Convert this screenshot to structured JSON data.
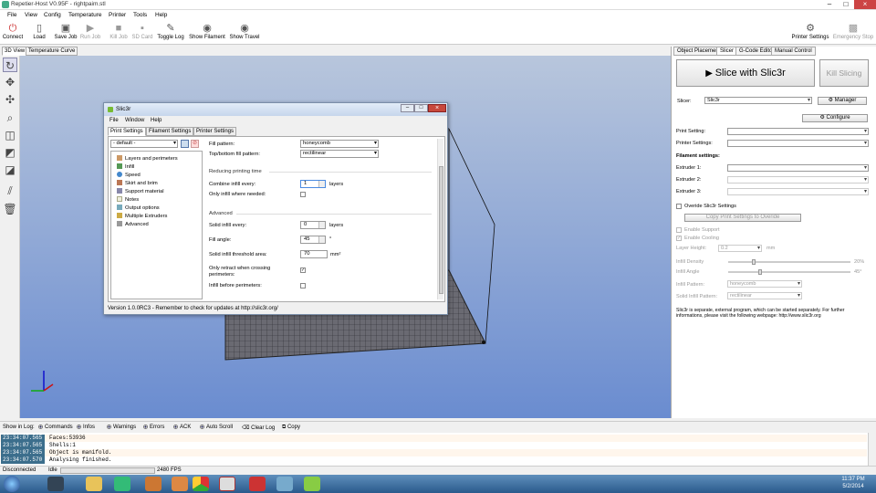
{
  "window": {
    "title": "Repetier-Host V0.95F - rightpaim.stl"
  },
  "menu": [
    "File",
    "View",
    "Config",
    "Temperature",
    "Printer",
    "Tools",
    "Help"
  ],
  "toolbar": {
    "items": [
      "Connect",
      "Load",
      "Save Job",
      "Run Job",
      "Kill Job",
      "SD Card",
      "Toggle Log",
      "Show Filament",
      "Show Travel"
    ],
    "right_items": [
      "Printer Settings",
      "Emergency Stop"
    ]
  },
  "view_tabs": [
    "3D View",
    "Temperature Curve"
  ],
  "right_tabs": [
    "Object Placement",
    "Slicer",
    "G-Code Editor",
    "Manual Control"
  ],
  "slicer": {
    "slice_button": "Slice with Slic3r",
    "kill_button": "Kill Slicing",
    "slicer_label": "Slicer:",
    "slicer_value": "Slic3r",
    "manager_button": "Manager",
    "configure_button": "Configure",
    "print_setting_label": "Print Setting:",
    "printer_settings_label": "Printer Settings:",
    "filament_settings_heading": "Filament settings:",
    "extruders": [
      "Extruder 1:",
      "Extruder 2:",
      "Extruder 3:"
    ],
    "override_label": "Overide Slic3r Settings",
    "copy_button": "Copy Print Settings to Overide",
    "enable_support": "Enable Support",
    "enable_cooling": "Enable Cooling",
    "layer_height_label": "Layer Height:",
    "layer_height_value": "0.2",
    "layer_height_unit": "mm",
    "infill_density_label": "Infill Density",
    "infill_density_value": "20%",
    "infill_density_fraction": 0.2,
    "infill_angle_label": "Infill Angle",
    "infill_angle_value": "45°",
    "infill_angle_fraction": 0.25,
    "infill_pattern_label": "Infill Pattern:",
    "infill_pattern_value": "honeycomb",
    "solid_infill_pattern_label": "Solid Infill Pattern:",
    "solid_infill_pattern_value": "rectilinear",
    "note_line1": "Slic3r is separate, external program, which can be started separately. For further",
    "note_line2": "informations, please visit the following webpage: http://www.slic3r.org"
  },
  "dialog": {
    "title": "Slic3r",
    "menu": [
      "File",
      "Window",
      "Help"
    ],
    "tabs": [
      "Print Settings",
      "Filament Settings",
      "Printer Settings"
    ],
    "preset": "- default -",
    "tree": [
      "Layers and perimeters",
      "Infill",
      "Speed",
      "Skirt and brim",
      "Support material",
      "Notes",
      "Output options",
      "Multiple Extruders",
      "Advanced"
    ],
    "fill_pattern_label": "Fill pattern:",
    "fill_pattern_value": "honeycomb",
    "top_bottom_label": "Top/bottom fill pattern:",
    "top_bottom_value": "rectilinear",
    "reducing_heading": "Reducing printing time",
    "combine_label": "Combine infill every:",
    "combine_value": "1",
    "combine_unit": "layers",
    "only_infill_label": "Only infill where needed:",
    "advanced_heading": "Advanced",
    "solid_every_label": "Solid infill every:",
    "solid_every_value": "0",
    "solid_every_unit": "layers",
    "fill_angle_label": "Fill angle:",
    "fill_angle_value": "45",
    "fill_angle_unit": "°",
    "threshold_label": "Solid infill threshold area:",
    "threshold_value": "70",
    "threshold_unit": "mm²",
    "only_retract_label1": "Only retract when crossing",
    "only_retract_label2": "perimeters:",
    "infill_before_label": "Infill before perimeters:",
    "status": "Version 1.0.0RC3 - Remember to check for updates at http://slic3r.org/"
  },
  "log": {
    "show_in_log": "Show in Log:",
    "options": [
      "Commands",
      "Infos",
      "Warnings",
      "Errors",
      "ACK",
      "Auto Scroll",
      "Clear Log",
      "Copy"
    ],
    "rows": [
      {
        "time": "23:34:07.565",
        "text": "Faces:53936"
      },
      {
        "time": "23:34:07.565",
        "text": "Shells:1"
      },
      {
        "time": "23:34:07.565",
        "text": "Object is manifold."
      },
      {
        "time": "23:34:07.570",
        "text": "Analysing finished."
      }
    ]
  },
  "status": {
    "connection": "Disconnected",
    "state": "Idle",
    "fps": "2480 FPS"
  },
  "taskbar": {
    "time": "11:37 PM",
    "date": "5/2/2014"
  },
  "colors": {
    "viewport_top": "#b8c6dc",
    "viewport_bottom": "#6a8cd0",
    "log_timestamp_bg": "#3c6e8c"
  }
}
